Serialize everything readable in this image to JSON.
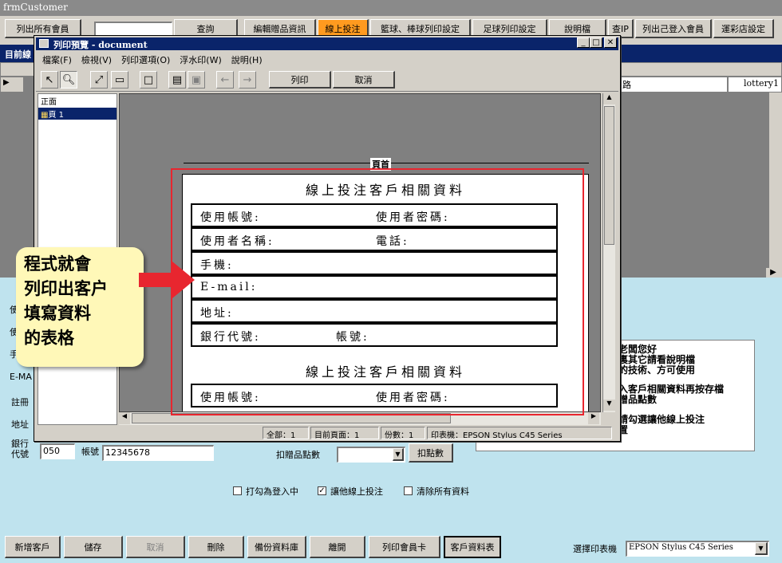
{
  "app": {
    "title": "frmCustomer"
  },
  "top_buttons": [
    "列出所有會員",
    "查詢",
    "編輯贈品資訊",
    "線上投注",
    "籃球、棒球列印設定",
    "足球列印設定",
    "說明檔",
    "查IP",
    "列出己登入會員",
    "運彩店設定"
  ],
  "active_top": "線上投注",
  "dark_band": "目前線",
  "grid": {
    "cell1": "路",
    "cell2": "lottery1",
    "row_marker": "▶"
  },
  "form_labels": [
    "使",
    "使",
    "手",
    "E-MA",
    "註冊",
    "地址"
  ],
  "bank": {
    "label": "銀行代號",
    "code": "050",
    "account_label": "帳號",
    "account": "12345678"
  },
  "gift": {
    "label": "扣贈品點數",
    "button": "扣點數",
    "dropdown_value": ""
  },
  "checkboxes": [
    {
      "label": "打勾為登入中",
      "checked": false
    },
    {
      "label": "讓他線上投注",
      "checked": true
    },
    {
      "label": "清除所有資料",
      "checked": false
    }
  ],
  "right_panel_lines": [
    "老闆您好",
    "裏其它請看說明檔",
    "的技術、方可使用",
    "入客戶相關資料再按存檔",
    "贈品點數",
    "請勾選讓他線上投注",
    "置"
  ],
  "bottom_buttons": [
    "新增客戶",
    "儲存",
    "取消",
    "刪除",
    "備份資料庫",
    "離開",
    "列印會員卡",
    "客戶資料表"
  ],
  "printer": {
    "label": "選擇印表機",
    "value": "EPSON Stylus C45 Series"
  },
  "preview_window": {
    "title": "列印預覽 - document",
    "menus": [
      "檔案(F)",
      "檢視(V)",
      "列印選項(O)",
      "浮水印(W)",
      "說明(H)"
    ],
    "print_button": "列印",
    "cancel_button": "取消",
    "tree_root": "正面",
    "tree_page": "頁 1",
    "page_header": "頁首",
    "status": {
      "total": "全部：1",
      "current": "目前頁面：1",
      "copies": "份數：1",
      "printer": "印表機：EPSON Stylus C45 Series"
    }
  },
  "form_sheet": {
    "title": "線上投注客戶相關資料",
    "rows": [
      {
        "left": "使用帳號:",
        "right": "使用者密碼:"
      },
      {
        "left": "使用者名稱:",
        "right": "電話:"
      },
      {
        "left": "手機:",
        "right": ""
      },
      {
        "left": "E-mail:",
        "right": ""
      },
      {
        "left": "地址:",
        "right": ""
      },
      {
        "left": "銀行代號:",
        "right": "帳號:"
      }
    ],
    "title2": "線上投注客戶相關資料",
    "row_repeat": {
      "left": "使用帳號:",
      "right": "使用者密碼:"
    }
  },
  "callout": [
    "程式就會",
    "列印出客户",
    "填寫資料",
    "的表格"
  ],
  "colors": {
    "accent_orange": "#ff9a1f",
    "title_blue": "#0a246a",
    "highlight_red": "#e8262f",
    "callout_yellow": "#fff8b8"
  }
}
